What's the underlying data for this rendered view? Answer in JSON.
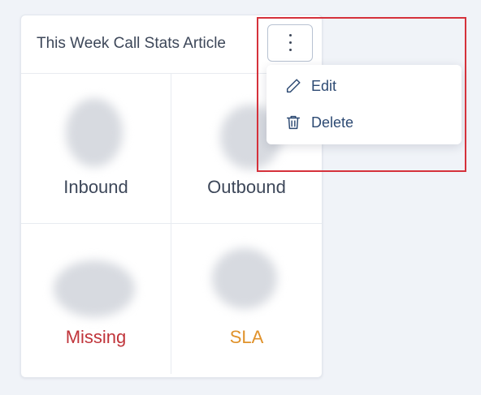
{
  "widget": {
    "title": "This Week Call Stats Article",
    "stats": [
      {
        "label": "Inbound",
        "color": "#3d4759"
      },
      {
        "label": "Outbound",
        "color": "#3d4759"
      },
      {
        "label": "Missing",
        "color": "#c0343a"
      },
      {
        "label": "SLA",
        "color": "#e0922b"
      }
    ]
  },
  "menu": {
    "trigger_icon": "more-vertical-icon",
    "items": [
      {
        "label": "Edit",
        "icon": "pencil-icon"
      },
      {
        "label": "Delete",
        "icon": "trash-icon"
      }
    ]
  },
  "highlight_color": "#d5313b"
}
